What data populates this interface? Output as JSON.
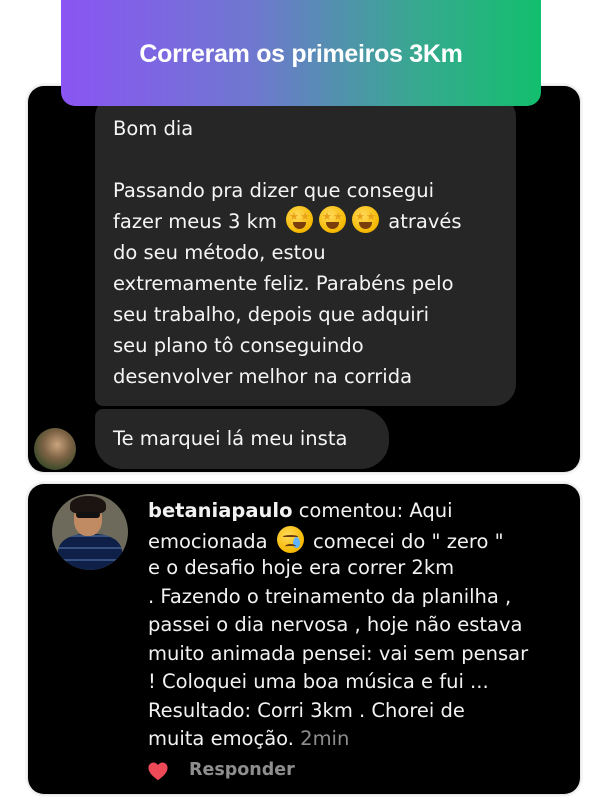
{
  "banner": {
    "title": "Correram os primeiros 3Km"
  },
  "dm": {
    "bubble_1": {
      "greeting": "Bom dia",
      "line_1": "Passando pra dizer que consegui",
      "line_2_before": "fazer meus 3 km",
      "line_2_after": "através",
      "line_3": "do seu método, estou",
      "line_4": "extremamente feliz. Parabéns pelo",
      "line_5": "seu trabalho, depois que adquiri",
      "line_6": "seu plano tô conseguindo",
      "line_7": "desenvolver melhor na corrida",
      "emoji": "star-struck-emoji"
    },
    "bubble_2": {
      "text": "Te marquei lá meu insta"
    },
    "avatar": "sender-avatar"
  },
  "comment": {
    "username": "betaniapaulo",
    "line_1_rest": "comentou: Aqui",
    "line_2_before": "emocionada",
    "line_2_after": "comecei do \" zero \"",
    "line_3": "e o desafio hoje era correr 2km",
    "line_4": ". Fazendo o treinamento da planilha ,",
    "line_5": "passei o dia nervosa , hoje não estava",
    "line_6": "muito animada pensei: vai sem pensar",
    "line_7": "! Coloquei uma boa música e fui ...",
    "line_8": "Resultado: Corri 3km . Chorei de",
    "line_9": "muita emoção.",
    "time": "2min",
    "emoji": "crying-face-emoji",
    "reply_label": "Responder",
    "like_icon": "heart-icon",
    "colors": {
      "heart": "#ed4956",
      "muted": "#8e8e8e"
    }
  }
}
